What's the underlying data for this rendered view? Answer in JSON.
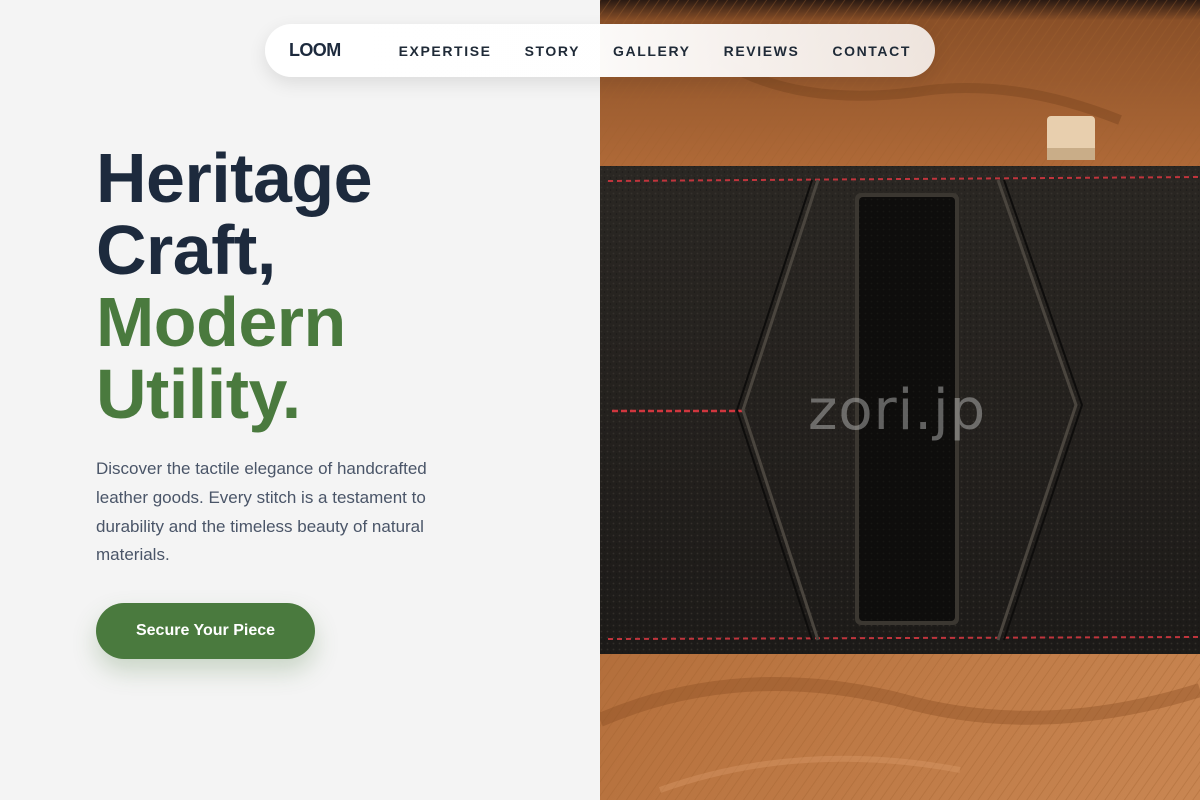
{
  "nav": {
    "brand": "LOOM",
    "links": [
      "EXPERTISE",
      "STORY",
      "GALLERY",
      "REVIEWS",
      "CONTACT"
    ]
  },
  "hero": {
    "headline_line1": "Heritage",
    "headline_line2": "Craft,",
    "headline_line3": "Modern",
    "headline_line4": "Utility.",
    "description": "Discover the tactile elegance of handcrafted leather goods. Every stitch is a testament to durability and the timeless beauty of natural materials.",
    "cta_label": "Secure Your Piece"
  },
  "image": {
    "subject": "leather-wallet-on-tan-fabric",
    "watermark": "zori.jp"
  },
  "colors": {
    "dark_text": "#1d2a3d",
    "accent_green": "#4a7a3e",
    "body_text": "#4a5568",
    "background": "#f4f4f4"
  }
}
